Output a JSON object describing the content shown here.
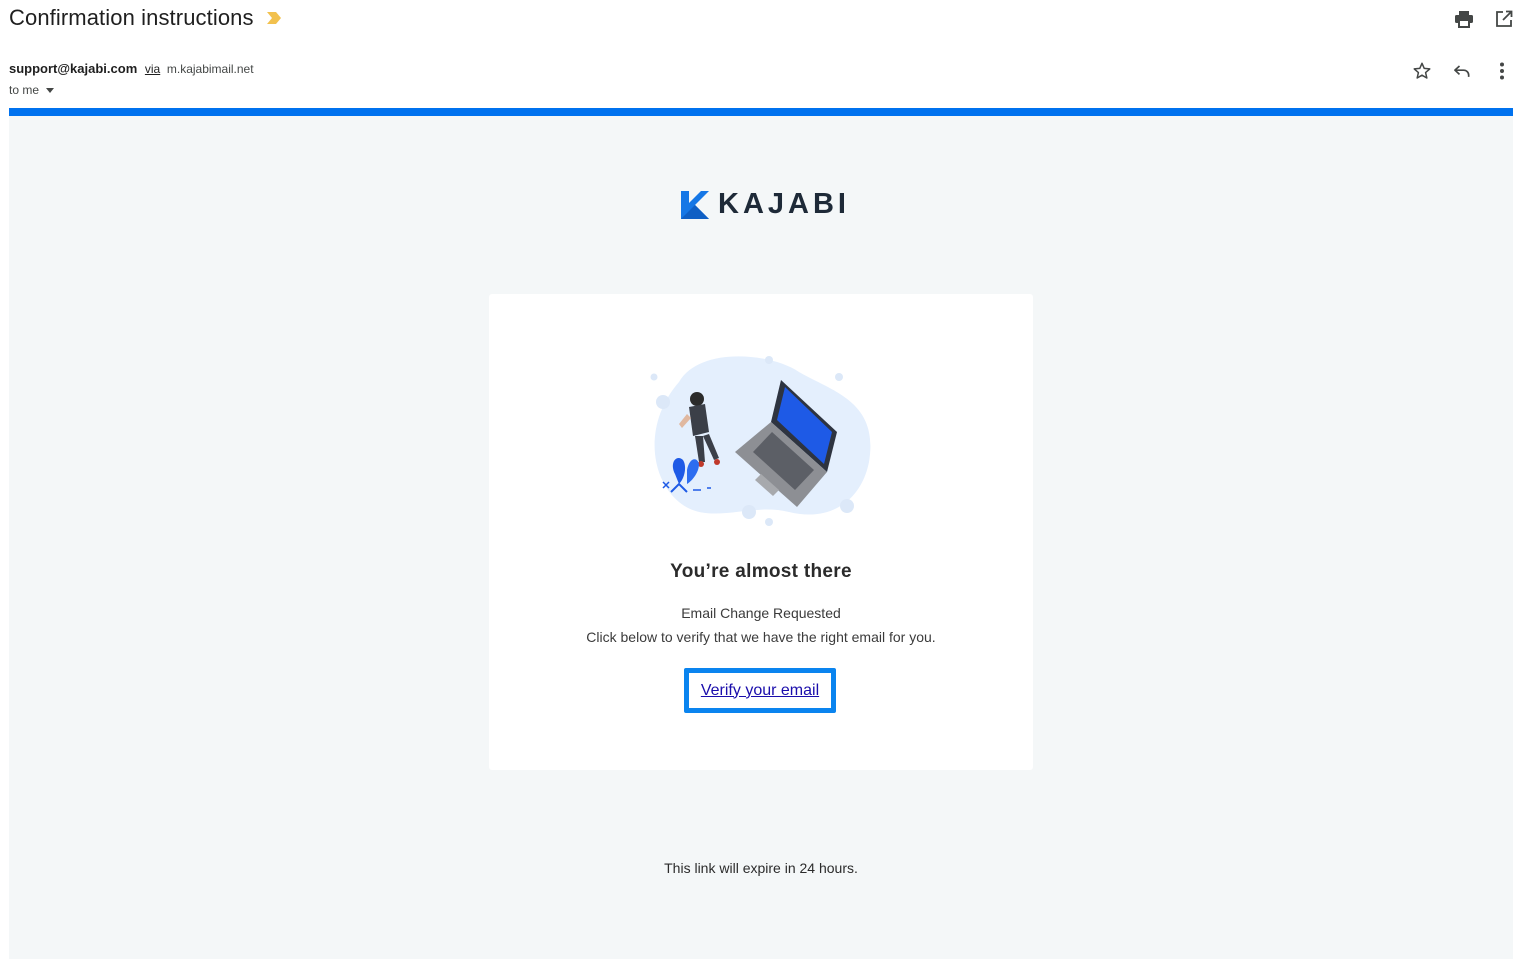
{
  "email": {
    "subject": "Confirmation instructions",
    "sender": "support@kajabi.com",
    "via_label": "via",
    "via_domain": "m.kajabimail.net",
    "recipient_label": "to me"
  },
  "icons": {
    "importance": "importance-marker-icon",
    "print": "print-icon",
    "open_new_window": "open-in-new-window-icon",
    "star": "star-icon",
    "reply": "reply-icon",
    "more": "more-vert-icon"
  },
  "body": {
    "brand": "KAJABI",
    "headline": "You’re almost there",
    "line1": "Email Change Requested",
    "line2": "Click below to verify that we have the right email for you.",
    "button_label": "Verify your email",
    "expire_notice": "This link will expire in 24 hours."
  },
  "colors": {
    "accent_bar": "#0072ef",
    "button_border": "#0a84ef",
    "importance": "#f2c14e",
    "body_background": "#f4f7f8"
  }
}
